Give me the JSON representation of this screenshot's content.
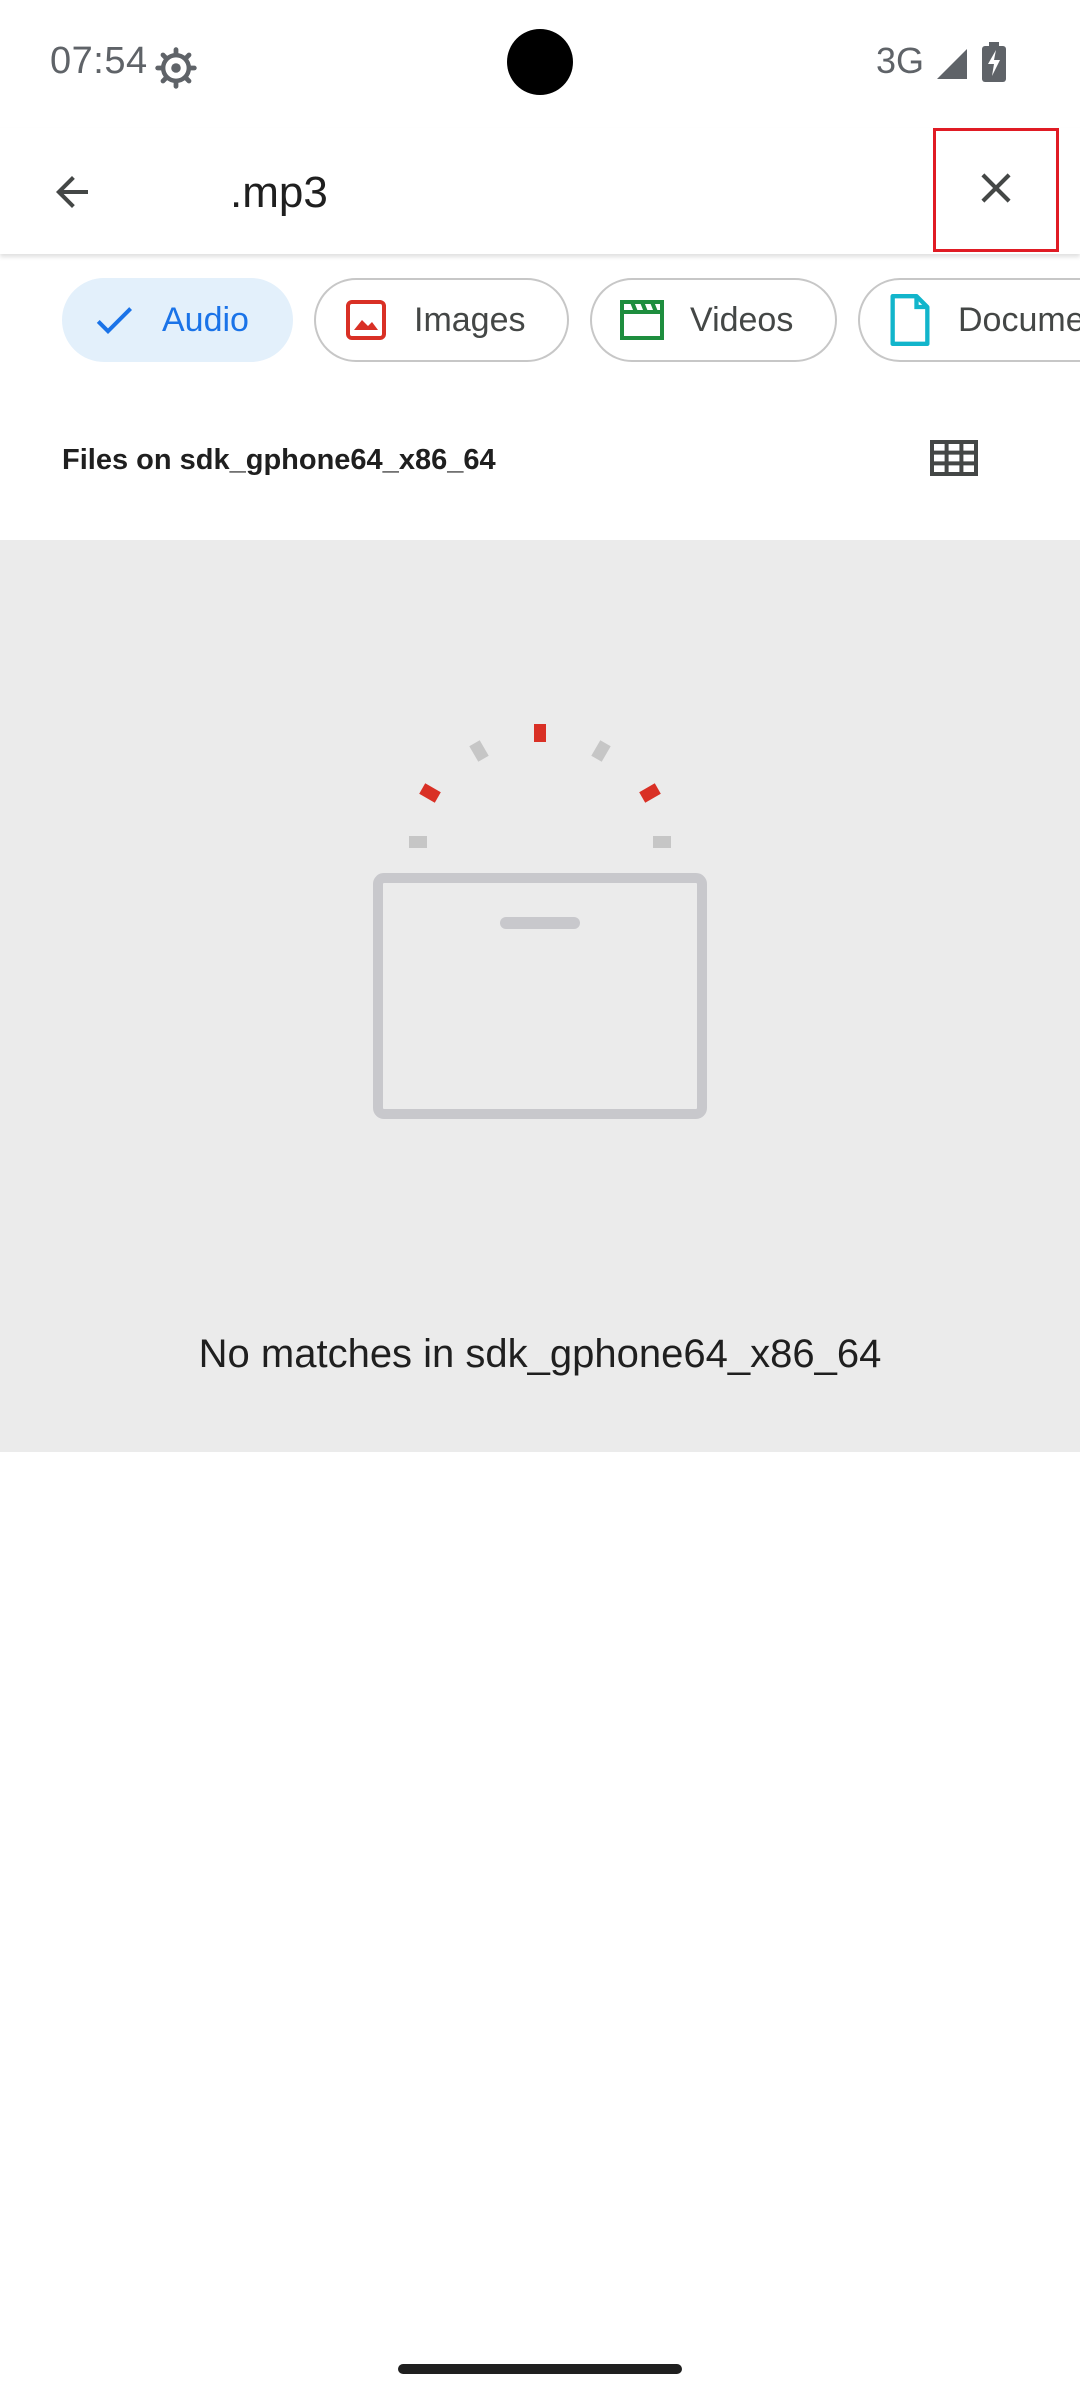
{
  "status_bar": {
    "time": "07:54",
    "network": "3G",
    "icons": [
      "settings-gear-icon",
      "signal-icon",
      "battery-charging-icon"
    ]
  },
  "search": {
    "query": ".mp3",
    "back_icon": "arrow-left-icon",
    "clear_icon": "close-icon"
  },
  "filters": [
    {
      "label": "Audio",
      "icon": "check-icon",
      "selected": true,
      "color": "#1a73e8"
    },
    {
      "label": "Images",
      "icon": "image-icon",
      "selected": false,
      "color": "#d93025"
    },
    {
      "label": "Videos",
      "icon": "clapperboard-icon",
      "selected": false,
      "color": "#1e8e3e"
    },
    {
      "label": "Documents",
      "icon": "document-icon",
      "selected": false,
      "color": "#12b5cb"
    }
  ],
  "section": {
    "title": "Files on sdk_gphone64_x86_64",
    "view_toggle_icon": "grid-view-icon"
  },
  "empty_state": {
    "message": "No matches in sdk_gphone64_x86_64",
    "illustration": "empty-box-icon"
  },
  "colors": {
    "accent": "#1a73e8",
    "panel_bg": "#ebebeb",
    "highlight_border": "#e01b24"
  }
}
